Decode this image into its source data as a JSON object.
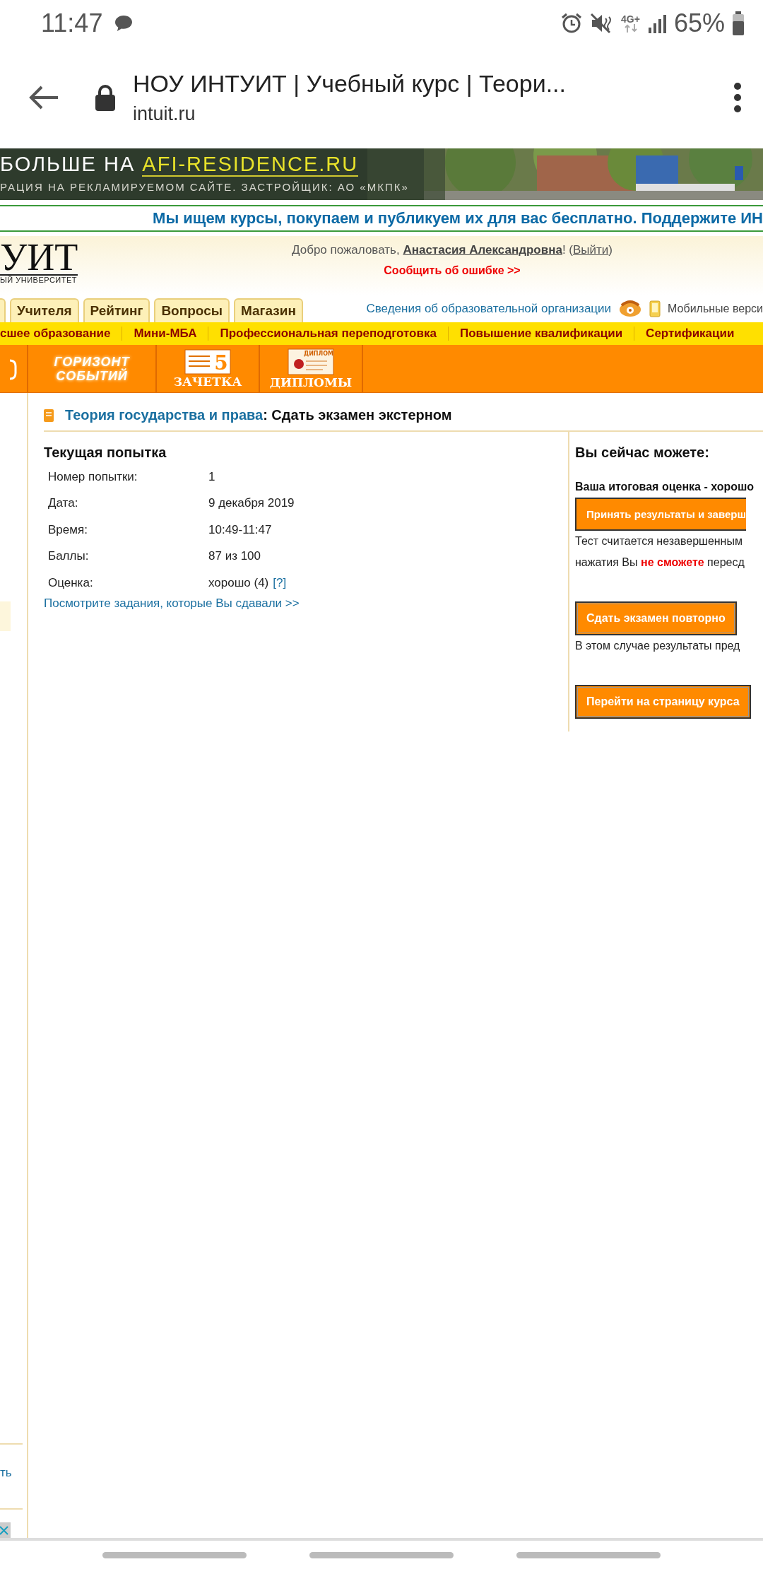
{
  "status_bar": {
    "time": "11:47",
    "network": "4G+",
    "battery": "65%"
  },
  "browser": {
    "title": "НОУ ИНТУИТ | Учебный курс | Теори...",
    "url": "intuit.ru"
  },
  "ad_banner": {
    "headline_prefix": "БОЛЬШЕ НА",
    "headline_site": "AFI-RESIDENCE.RU",
    "subline": "РАЦИЯ НА РЕКЛАМИРУЕМОМ САЙТЕ. ЗАСТРОЙЩИК: АО «МКПК»"
  },
  "notice": "Мы ищем курсы, покупаем и публикуем их для вас бесплатно. Поддержите ИН",
  "header": {
    "logo": "УИТ",
    "logo_caption": "ЫЙ УНИВЕРСИТЕТ",
    "welcome_before": "Добро пожаловать, ",
    "user": "Анастасия Александровна",
    "welcome_middle": "! (",
    "logout": "Выйти",
    "welcome_after": ")",
    "report_error": "Сообщить об ошибке >>"
  },
  "tabs": [
    "Учителя",
    "Рейтинг",
    "Вопросы",
    "Магазин"
  ],
  "org_info_link": "Сведения об образовательной организации",
  "mobile_link": "Мобильные верси",
  "menu": [
    "сшее образование",
    "Мини-МБА",
    "Профессиональная переподготовка",
    "Повышение квалификации",
    "Сертификации"
  ],
  "banner": [
    {
      "kind": "horizon",
      "lines": [
        "ГОРИЗОНТ",
        "СОБЫТИЙ"
      ]
    },
    {
      "kind": "gradebook",
      "badge": "5",
      "label": "ЗАЧЕТКА"
    },
    {
      "kind": "diplomas",
      "badge": "ДИПЛОМ",
      "label": "ДИПЛОМЫ"
    }
  ],
  "page": {
    "course": "Теория государства и права",
    "title_rest": ": Сдать экзамен экстерном"
  },
  "attempt": {
    "heading": "Текущая попытка",
    "rows": [
      {
        "label": "Номер попытки:",
        "value": "1"
      },
      {
        "label": "Дата:",
        "value": "9 декабря 2019"
      },
      {
        "label": "Время:",
        "value": "10:49-11:47"
      },
      {
        "label": "Баллы:",
        "value": "87 из 100"
      },
      {
        "label": "Оценка:",
        "value": "хорошо (4)",
        "help": "[?]"
      }
    ],
    "tasks_link": "Посмотрите задания, которые Вы сдавали >>"
  },
  "actions": {
    "heading": "Вы сейчас можете:",
    "final_grade": "Ваша итоговая оценка - хорошо",
    "items": [
      {
        "button": "Принять результаты и заверш",
        "notes": [
          "Тест считается незавершенным",
          "нажатия Вы **не сможете** пересд"
        ]
      },
      {
        "button": "Сдать экзамен повторно",
        "notes": [
          "В этом случае результаты пред"
        ]
      },
      {
        "button": "Перейти на страницу курса"
      }
    ]
  },
  "sidebar": {
    "link": "ть"
  }
}
